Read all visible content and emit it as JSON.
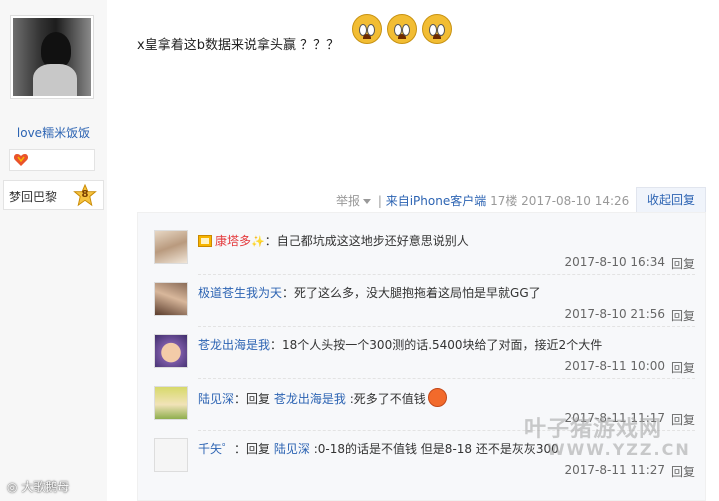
{
  "author": {
    "username": "love糯米饭饭",
    "badge_text": "梦回巴黎",
    "level": "8"
  },
  "post": {
    "text": "x皇拿着这b数据来说拿头赢 ？？？",
    "emoji_icon": "crying-face-icon"
  },
  "meta": {
    "report": "举报",
    "client": "来自iPhone客户端",
    "floor": "17楼",
    "timestamp": "2017-08-10 14:26",
    "collapse": "收起回复"
  },
  "replies": [
    {
      "name": "康塔多",
      "sep": "：",
      "content": "自己都坑成这这地步还好意思说别人",
      "time": "2017-8-10 16:34",
      "action": "回复"
    },
    {
      "name": "极道苍生我为天",
      "sep": "：",
      "content": "死了这么多，没大腿抱拖着这局怕是早就GG了",
      "time": "2017-8-10 21:56",
      "action": "回复"
    },
    {
      "name": "苍龙出海是我",
      "sep": "：",
      "content": "18个人头按一个300测的话.5400块给了对面，接近2个大件",
      "time": "2017-8-11 10:00",
      "action": "回复"
    },
    {
      "name": "陆见深",
      "sep": "：",
      "reply_word": "回复",
      "target": "苍龙出海是我",
      "content": ":死多了不值钱",
      "time": "2017-8-11 11:17",
      "action": "回复"
    },
    {
      "name": "千矢゜",
      "sep": "：",
      "reply_word": "回复",
      "target": "陆见深",
      "content": ":0-18的话是不值钱 但是8-18 还不是灰灰300",
      "time": "2017-8-11 11:27",
      "action": "回复"
    }
  ],
  "watermarks": {
    "left": "大歌鹅母",
    "right": "叶子猪游戏网",
    "url": "WWW.YZZ.CN"
  }
}
